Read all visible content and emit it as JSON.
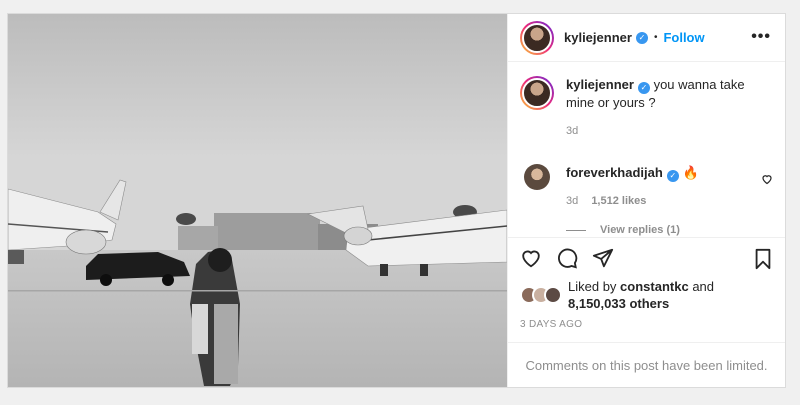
{
  "post": {
    "author": "kyliejenner",
    "follow_label": "Follow",
    "more_label": "•••",
    "caption": {
      "username": "kyliejenner",
      "text": "you wanna take mine or yours ?",
      "time": "3d"
    },
    "comment": {
      "username": "foreverkhadijah",
      "text": "🔥",
      "time": "3d",
      "likes": "1,512 likes",
      "view_replies": "View replies (1)"
    },
    "likes": {
      "prefix": "Liked by",
      "user": "constantkc",
      "conjunction": "and",
      "count": "8,150,033 others"
    },
    "date": "3 DAYS AGO",
    "comments_limited": "Comments on this post have been limited."
  },
  "icons": {
    "like": "heart-icon",
    "comment": "comment-icon",
    "share": "share-icon",
    "save": "bookmark-icon",
    "verified": "verified-badge-icon"
  },
  "colors": {
    "link": "#0095f6",
    "verified": "#3897f0",
    "muted": "#8e8e8e"
  }
}
